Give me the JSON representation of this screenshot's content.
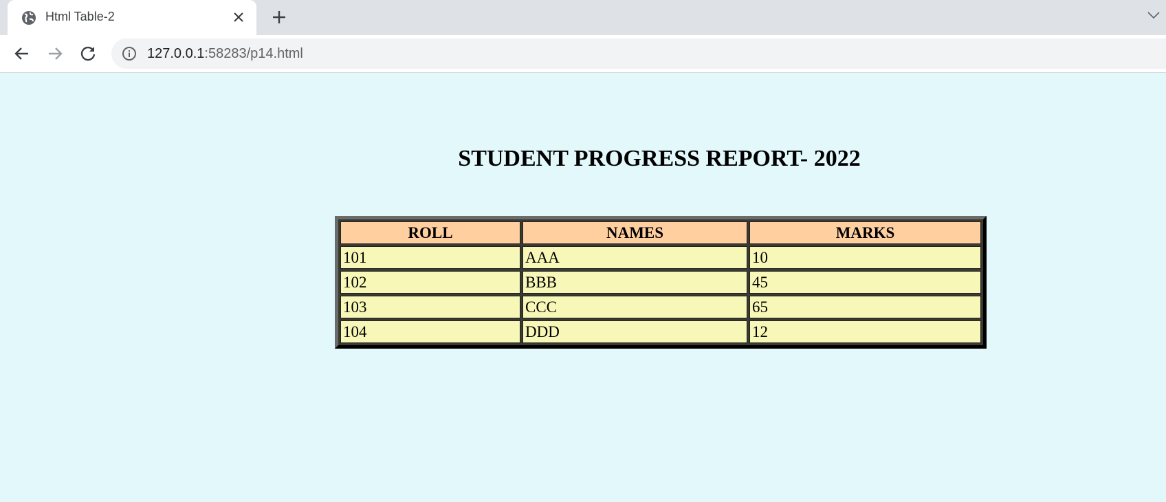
{
  "browser": {
    "tab_title": "Html Table-2",
    "url_host": "127.0.0.1",
    "url_rest": ":58283/p14.html"
  },
  "page": {
    "title": "STUDENT PROGRESS REPORT- 2022",
    "background": "#e2f8fb"
  },
  "table": {
    "headers": [
      "ROLL",
      "NAMES",
      "MARKS"
    ],
    "rows": [
      [
        "101",
        "AAA",
        "10"
      ],
      [
        "102",
        "BBB",
        "45"
      ],
      [
        "103",
        "CCC",
        "65"
      ],
      [
        "104",
        "DDD",
        "12"
      ]
    ],
    "header_color": "#ffcfa0",
    "cell_color": "#f7f7b8"
  },
  "icons": {
    "tab": "globe-icon",
    "close": "close-icon",
    "new_tab": "plus-icon",
    "back": "back-arrow-icon",
    "forward": "forward-arrow-icon",
    "reload": "reload-icon",
    "site_info": "info-icon",
    "tab_menu": "chevron-down-icon"
  }
}
